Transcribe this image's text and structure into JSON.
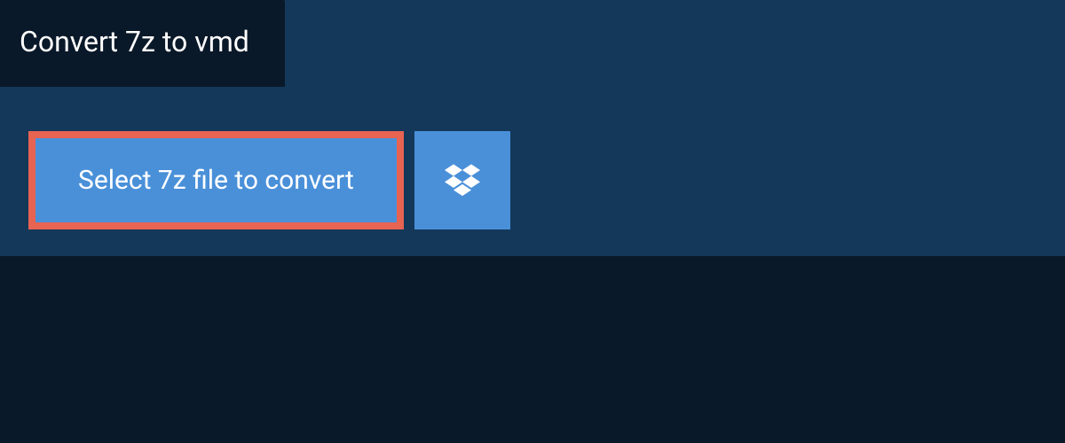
{
  "tab": {
    "title": "Convert 7z to vmd"
  },
  "actions": {
    "select_file_label": "Select 7z file to convert",
    "dropbox_icon": "dropbox-icon"
  },
  "colors": {
    "background": "#0a1929",
    "panel": "#14385a",
    "button": "#4a90d9",
    "highlight_border": "#e76352"
  }
}
